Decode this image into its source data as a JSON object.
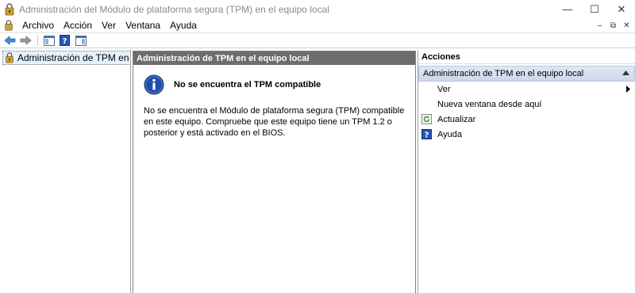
{
  "window": {
    "title": "Administración del Módulo de plataforma segura (TPM) en el equipo local",
    "controls": {
      "minimize": "—",
      "maximize": "☐",
      "close": "✕"
    }
  },
  "menubar": {
    "items": [
      "Archivo",
      "Acción",
      "Ver",
      "Ventana",
      "Ayuda"
    ],
    "mdi": {
      "minimize": "–",
      "restore": "⧉",
      "close": "✕"
    }
  },
  "toolbar": {
    "icons": [
      "back-icon",
      "forward-icon",
      "show-hide-tree-icon",
      "help-icon",
      "show-hide-action-pane-icon"
    ]
  },
  "tree": {
    "items": [
      {
        "label": "Administración de TPM en el equipo local"
      }
    ]
  },
  "main": {
    "header": "Administración de TPM en el equipo local",
    "info_title": "No se encuentra el TPM compatible",
    "info_body": "No se encuentra el Módulo de plataforma segura (TPM) compatible en este equipo. Compruebe que este equipo tiene un TPM 1.2 o posterior y está activado en el BIOS."
  },
  "actions": {
    "header": "Acciones",
    "section": "Administración de TPM en el equipo local",
    "items": [
      {
        "label": "Ver",
        "submenu": true
      },
      {
        "label": "Nueva ventana desde aquí"
      },
      {
        "label": "Actualizar",
        "icon": "refresh-icon"
      },
      {
        "label": "Ayuda",
        "icon": "help-icon"
      }
    ]
  },
  "colors": {
    "pane_header_bg": "#6d6d6d",
    "section_header_bg": "#d6e0ef",
    "info_blue": "#1f4fa8"
  }
}
